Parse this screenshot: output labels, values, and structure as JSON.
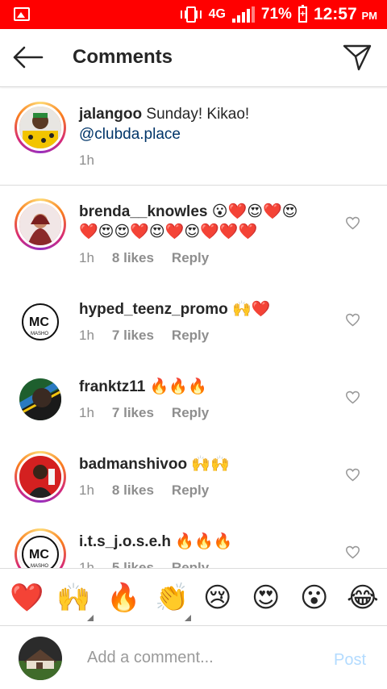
{
  "status_bar": {
    "network": "4G",
    "battery": "71%",
    "time": "12:57",
    "ampm": "PM"
  },
  "header": {
    "title": "Comments"
  },
  "caption": {
    "username": "jalangoo",
    "text": " Sunday! Kikao!",
    "mention": "@clubda.place",
    "time": "1h"
  },
  "comments": [
    {
      "username": "brenda__knowles",
      "text": " 😮❤️😍❤️😍",
      "text2": "❤️😍😍❤️😍❤️😍❤️❤️❤️",
      "time": "1h",
      "likes": "8 likes",
      "reply": "Reply"
    },
    {
      "username": "hyped_teenz_promo",
      "text": " 🙌❤️",
      "time": "1h",
      "likes": "7 likes",
      "reply": "Reply"
    },
    {
      "username": "franktz11",
      "text": " 🔥🔥🔥",
      "time": "1h",
      "likes": "7 likes",
      "reply": "Reply"
    },
    {
      "username": "badmanshivoo",
      "text": " 🙌🙌",
      "time": "1h",
      "likes": "8 likes",
      "reply": "Reply"
    },
    {
      "username": "i.t.s_j.o.s.e.h",
      "text": " 🔥🔥🔥",
      "time": "1h",
      "likes": "5 likes",
      "reply": "Reply"
    }
  ],
  "reactions": [
    "❤️",
    "🙌",
    "🔥",
    "👏",
    "😢",
    "😍",
    "😮",
    "😂"
  ],
  "input": {
    "placeholder": "Add a comment...",
    "post_label": "Post"
  },
  "colors": {
    "status_bar": "#ff0000",
    "mention": "#003569",
    "post_disabled": "#b3dbff"
  }
}
